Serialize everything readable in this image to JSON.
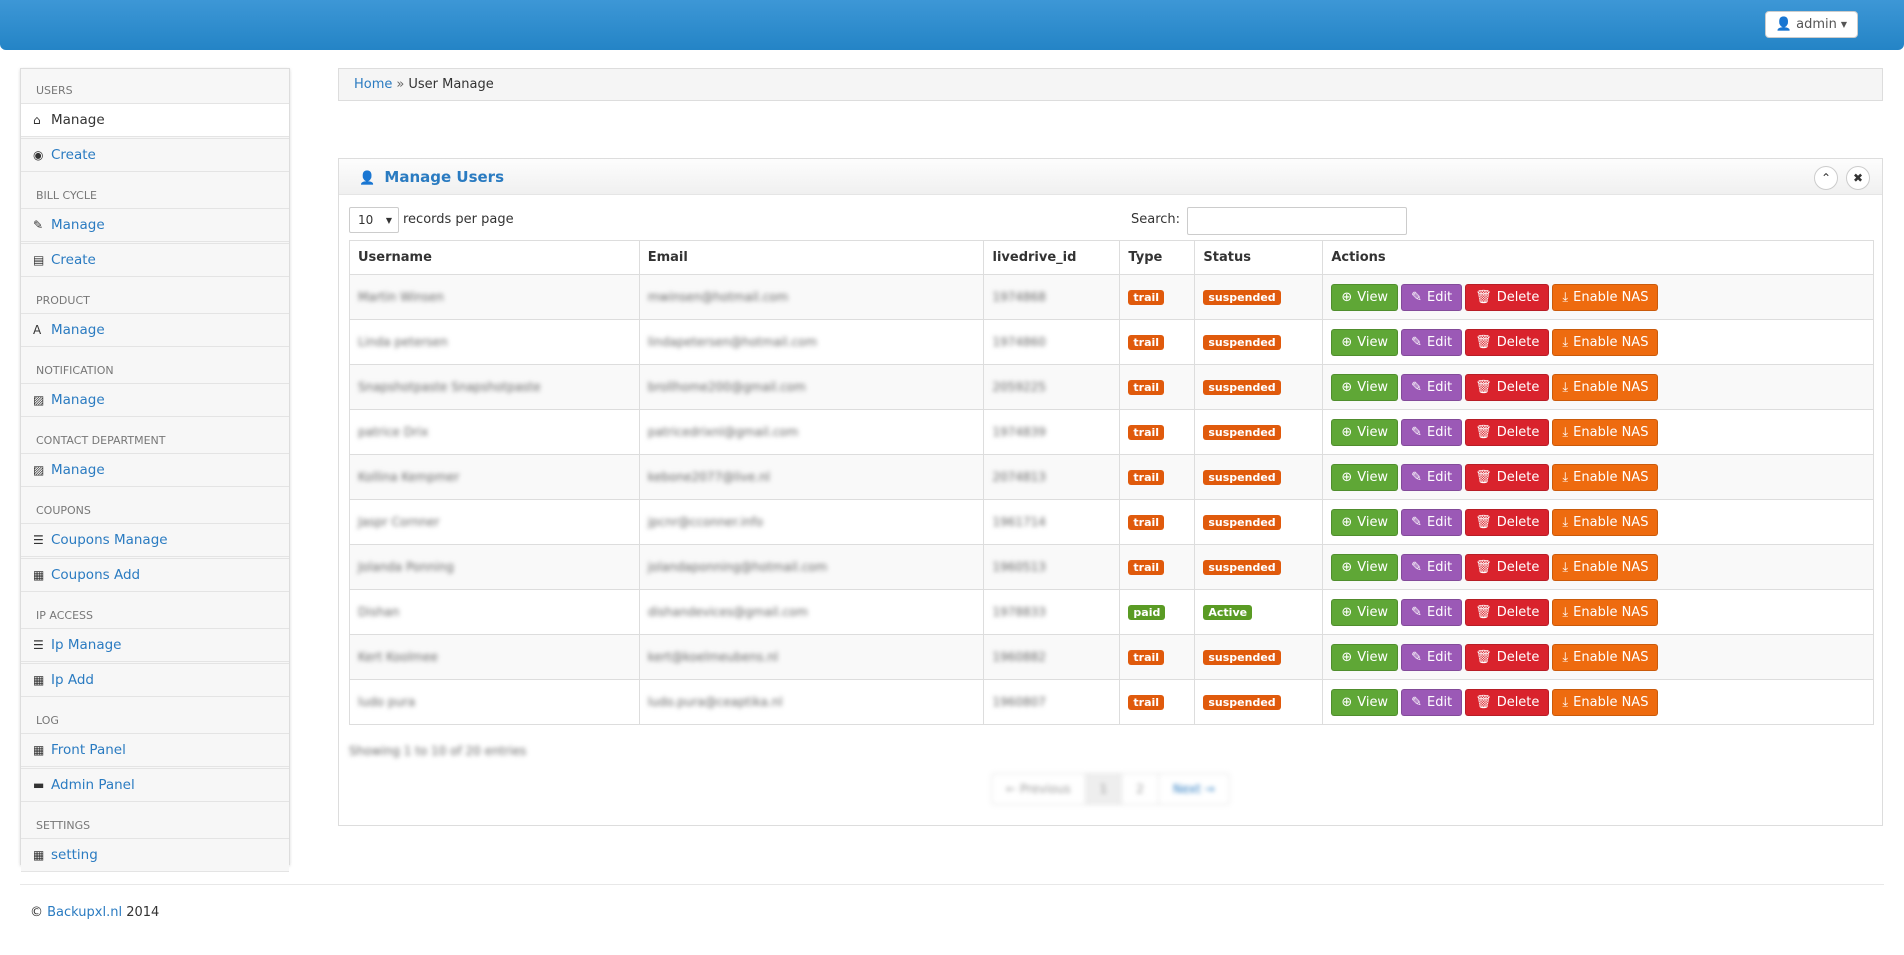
{
  "topbar": {
    "user_label": "admin"
  },
  "sidebar": [
    {
      "heading": "USERS",
      "items": [
        {
          "label": "Manage",
          "icon": "home-icon",
          "glyph": "⌂",
          "active": true
        },
        {
          "label": "Create",
          "icon": "eye-icon",
          "glyph": "◉",
          "active": false
        }
      ]
    },
    {
      "heading": "BILL CYCLE",
      "items": [
        {
          "label": "Manage",
          "icon": "edit-icon",
          "glyph": "✎",
          "active": false
        },
        {
          "label": "Create",
          "icon": "list-alt-icon",
          "glyph": "▤",
          "active": false
        }
      ]
    },
    {
      "heading": "PRODUCT",
      "items": [
        {
          "label": "Manage",
          "icon": "font-icon",
          "glyph": "A",
          "active": false
        }
      ]
    },
    {
      "heading": "NOTIFICATION",
      "items": [
        {
          "label": "Manage",
          "icon": "picture-icon",
          "glyph": "▨",
          "active": false
        }
      ]
    },
    {
      "heading": "CONTACT DEPARTMENT",
      "items": [
        {
          "label": "Manage",
          "icon": "picture-icon",
          "glyph": "▨",
          "active": false
        }
      ]
    },
    {
      "heading": "COUPONS",
      "items": [
        {
          "label": "Coupons Manage",
          "icon": "list-icon",
          "glyph": "☰",
          "active": false
        },
        {
          "label": "Coupons Add",
          "icon": "calendar-icon",
          "glyph": "▦",
          "active": false
        }
      ]
    },
    {
      "heading": "IP ACCESS",
      "items": [
        {
          "label": "Ip Manage",
          "icon": "list-icon",
          "glyph": "☰",
          "active": false
        },
        {
          "label": "Ip Add",
          "icon": "calendar-icon",
          "glyph": "▦",
          "active": false
        }
      ]
    },
    {
      "heading": "LOG",
      "items": [
        {
          "label": "Front Panel",
          "icon": "grid-icon",
          "glyph": "▦",
          "active": false
        },
        {
          "label": "Admin Panel",
          "icon": "folder-icon",
          "glyph": "▬",
          "active": false
        }
      ]
    },
    {
      "heading": "SETTINGS",
      "items": [
        {
          "label": "setting",
          "icon": "grid-icon",
          "glyph": "▦",
          "active": false
        }
      ]
    }
  ],
  "breadcrumb": {
    "home": "Home",
    "separator": "»",
    "current": "User Manage"
  },
  "panel": {
    "title": "Manage Users",
    "length_value": "10",
    "length_label": "records per page",
    "search_label": "Search:",
    "columns": [
      "Username",
      "Email",
      "livedrive_id",
      "Type",
      "Status",
      "Actions"
    ],
    "rows": [
      {
        "username": "Martin Winsen",
        "email": "mwinsen@hotmail.com",
        "livedrive_id": "1974868",
        "type": "trail",
        "status": "suspended"
      },
      {
        "username": "Linda petersen",
        "email": "lindapetersen@hotmail.com",
        "livedrive_id": "1974860",
        "type": "trail",
        "status": "suspended"
      },
      {
        "username": "Snapshotpaste Snapshotpaste",
        "email": "brollhome200@gmail.com",
        "livedrive_id": "2059225",
        "type": "trail",
        "status": "suspended"
      },
      {
        "username": "patrice Drix",
        "email": "patricedrixnl@gmail.com",
        "livedrive_id": "1974839",
        "type": "trail",
        "status": "suspended"
      },
      {
        "username": "Kollina Kempmer",
        "email": "kebone2077@live.nl",
        "livedrive_id": "2074813",
        "type": "trail",
        "status": "suspended"
      },
      {
        "username": "Jaspr Cornner",
        "email": "jpcnr@cconner.info",
        "livedrive_id": "1961714",
        "type": "trail",
        "status": "suspended"
      },
      {
        "username": "Jolanda Ponning",
        "email": "jolandaponning@hotmail.com",
        "livedrive_id": "1960513",
        "type": "trail",
        "status": "suspended"
      },
      {
        "username": "Dishan",
        "email": "dishandevices@gmail.com",
        "livedrive_id": "1978833",
        "type": "paid",
        "status": "Active"
      },
      {
        "username": "Kert Koolmee",
        "email": "kert@koelmeubens.nl",
        "livedrive_id": "1960882",
        "type": "trail",
        "status": "suspended"
      },
      {
        "username": "ludo pura",
        "email": "ludo.pura@ceaptika.nl",
        "livedrive_id": "1960807",
        "type": "trail",
        "status": "suspended"
      }
    ],
    "actions": {
      "view": "View",
      "edit": "Edit",
      "delete": "Delete",
      "nas": "Enable NAS"
    },
    "info": "Showing 1 to 10 of 20 entries",
    "pager": {
      "prev": "← Previous",
      "pages": [
        "1",
        "2"
      ],
      "next": "Next →"
    }
  },
  "footer": {
    "copyright": "©",
    "site": "Backupxl.nl",
    "year": "2014"
  },
  "colors": {
    "topbar": "#2d8dcf",
    "link": "#2a7bc1",
    "view": "#5fa736",
    "edit": "#9b59b6",
    "delete": "#d9232d",
    "nas": "#ee6b0f",
    "badge_trail": "#e05a0c",
    "badge_paid": "#5a9b24"
  }
}
